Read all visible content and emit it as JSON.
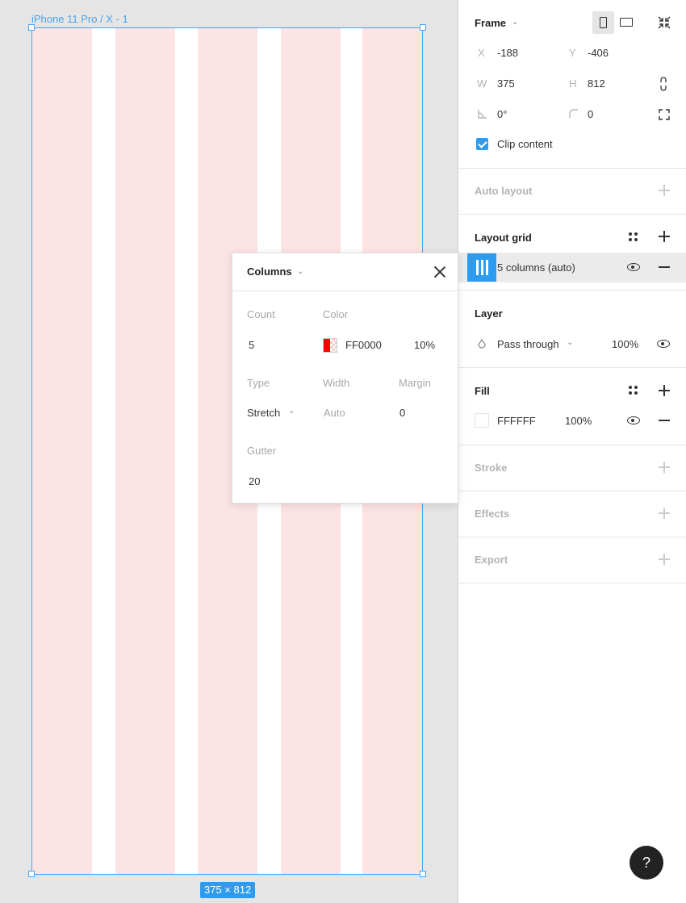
{
  "canvas": {
    "frame_label": "iPhone 11 Pro / X - 1",
    "size_badge": "375 × 812"
  },
  "popover": {
    "title": "Columns",
    "count_label": "Count",
    "count_value": "5",
    "color_label": "Color",
    "color_hex": "FF0000",
    "color_opacity": "10%",
    "type_label": "Type",
    "type_value": "Stretch",
    "width_label": "Width",
    "width_value": "Auto",
    "margin_label": "Margin",
    "margin_value": "0",
    "gutter_label": "Gutter",
    "gutter_value": "20"
  },
  "panel": {
    "frame": {
      "title": "Frame",
      "x_label": "X",
      "x_value": "-188",
      "y_label": "Y",
      "y_value": "-406",
      "w_label": "W",
      "w_value": "375",
      "h_label": "H",
      "h_value": "812",
      "rotation_value": "0°",
      "radius_value": "0",
      "clip_label": "Clip content"
    },
    "auto_layout": {
      "title": "Auto layout"
    },
    "layout_grid": {
      "title": "Layout grid",
      "item_label": "5 columns (auto)"
    },
    "layer": {
      "title": "Layer",
      "blend_mode": "Pass through",
      "opacity": "100%"
    },
    "fill": {
      "title": "Fill",
      "hex": "FFFFFF",
      "opacity": "100%"
    },
    "stroke": {
      "title": "Stroke"
    },
    "effects": {
      "title": "Effects"
    },
    "export": {
      "title": "Export"
    }
  },
  "help_button": "?",
  "colors": {
    "accent": "#2d9cf0",
    "grid_column": "#fde4e4",
    "grid_color": "#FF0000"
  }
}
